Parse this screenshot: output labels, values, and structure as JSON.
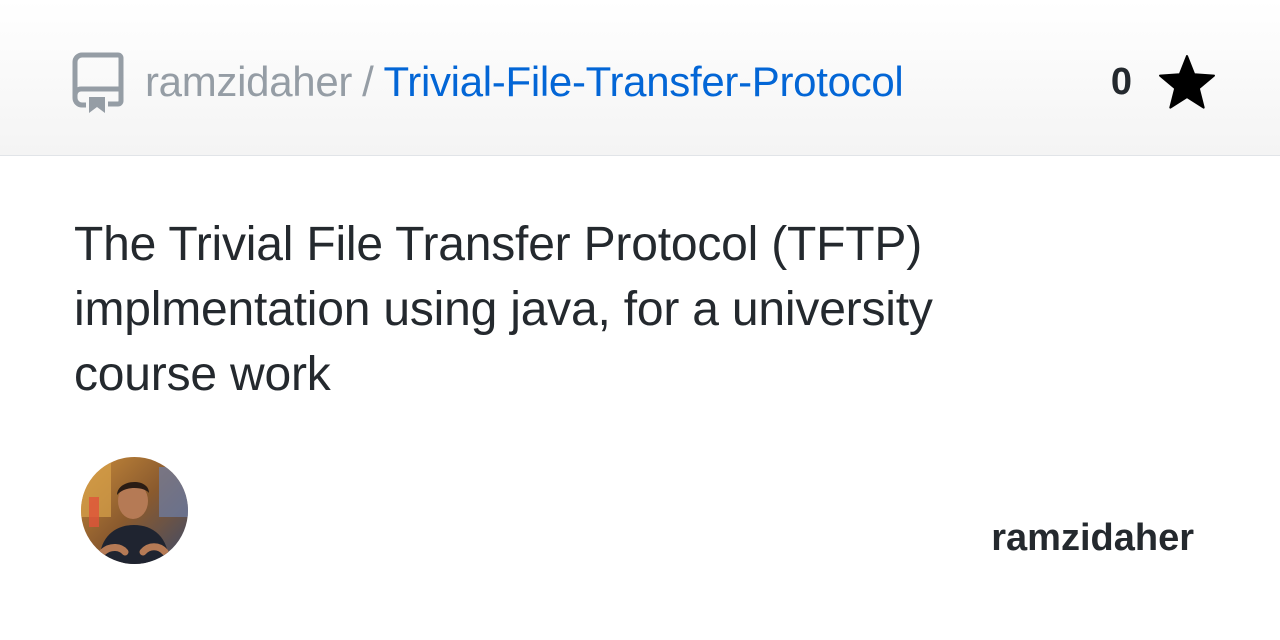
{
  "header": {
    "owner": "ramzidaher",
    "separator": "/",
    "repo_name": "Trivial-File-Transfer-Protocol",
    "repo_icon": "repo-icon",
    "star_count": "0",
    "star_icon": "star-icon"
  },
  "description": "The Trivial File Transfer Protocol (TFTP) implmentation using java, for a university course work",
  "footer": {
    "avatar_icon": "user-avatar",
    "username": "ramzidaher"
  },
  "colors": {
    "link": "#0366d6",
    "muted": "#959da5",
    "text": "#24292e"
  }
}
